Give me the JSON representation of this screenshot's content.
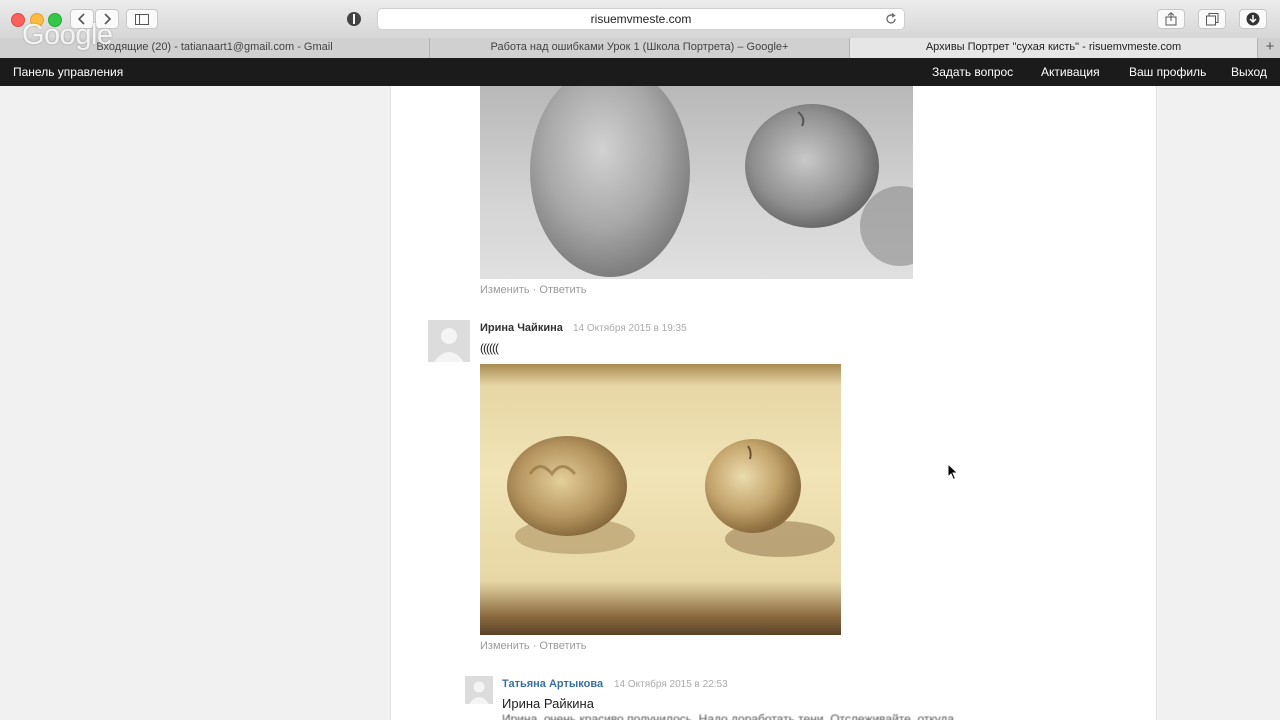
{
  "browser": {
    "url": "risuemvmeste.com",
    "google_logo": "Google",
    "tabs": [
      {
        "label": "Входящие (20) - tatianaart1@gmail.com - Gmail"
      },
      {
        "label": "Работа над ошибками Урок 1 (Школа Портрета) – Google+"
      },
      {
        "label": "Архивы Портрет \"сухая кисть\" - risuemvmeste.com"
      }
    ],
    "new_tab": "+"
  },
  "adminbar": {
    "left_label": "Панель управления",
    "links": [
      "Задать вопрос",
      "Активация",
      "Ваш профиль",
      "Выход"
    ]
  },
  "comments": {
    "actions": {
      "edit": "Изменить",
      "separator": "·",
      "reply": "Ответить"
    },
    "items": [
      {
        "author": "Ирина Чайкина",
        "date": "14 Октября 2015 в 19:35",
        "text": "(((((("
      },
      {
        "author": "Татьяна Артыкова",
        "date": "14 Октября 2015 в 22:53",
        "text": "Ирина Райкина",
        "text2": "Ирина, очень красиво получилось. Надо доработать тени. Отслеживайте, откуда"
      }
    ]
  }
}
